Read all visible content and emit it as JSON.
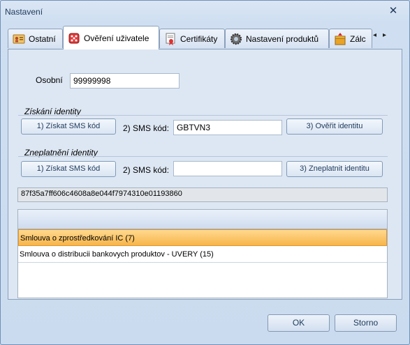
{
  "window": {
    "title": "Nastavení",
    "close_glyph": "✕"
  },
  "tabs": [
    {
      "label": "Ostatní",
      "icon": "id-card-icon"
    },
    {
      "label": "Ověření uživatele",
      "icon": "dice-icon"
    },
    {
      "label": "Certifikáty",
      "icon": "certificate-icon"
    },
    {
      "label": "Nastavení produktů",
      "icon": "gear-icon"
    },
    {
      "label": "Zálc",
      "icon": "box-icon"
    }
  ],
  "tab_scroll": {
    "prev": "◂",
    "next": "▸"
  },
  "user": {
    "label": "Osobní",
    "value": "99999998"
  },
  "acquire_identity": {
    "title": "Získání identity",
    "get_sms_button": "1) Získat SMS kód",
    "sms_label": "2) SMS kód:",
    "sms_value": "GBTVN3",
    "verify_button": "3) Ověřit identitu"
  },
  "revoke_identity": {
    "title": "Zneplatnění identity",
    "get_sms_button": "1) Získat SMS kód",
    "sms_label": "2) SMS kód:",
    "sms_value": "",
    "revoke_button": "3) Zneplatnit identitu"
  },
  "hash": "87f35a7ff606c4608a8e044f7974310e01193860",
  "contracts": [
    {
      "label": "Smlouva o zprostředkování IC (7)",
      "selected": true
    },
    {
      "label": "Smlouva o distribucii bankovych produktov - UVERY (15)",
      "selected": false
    }
  ],
  "footer": {
    "ok": "OK",
    "cancel": "Storno"
  }
}
